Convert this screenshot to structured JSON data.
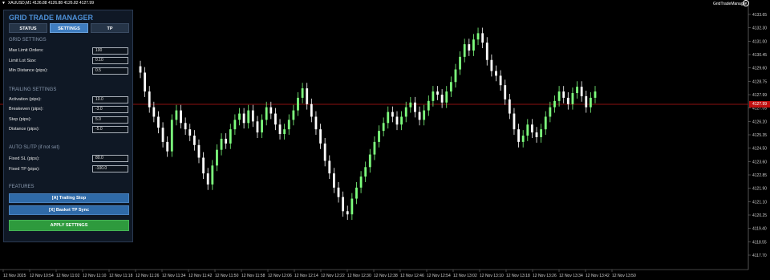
{
  "chart_header": {
    "symbol_line": "XAUUSD,M1  4126.88 4126.88 4126.82 4127.99"
  },
  "ea_label": "GridTradeManager",
  "colors": {
    "bull": "#7dff7d",
    "bear": "#ffffff",
    "bid_line": "#8b1010",
    "panel_bg": "#0f1825",
    "accent": "#4d8fd6",
    "apply": "#2e9a3d"
  },
  "current_price": "4127.99",
  "chart_data": {
    "type": "candlestick",
    "price_range": [
      4116.5,
      4133.0
    ],
    "y_ticks": [
      "4133.65",
      "4132.30",
      "4131.00",
      "4130.45",
      "4129.60",
      "4128.75",
      "4127.99",
      "4127.05",
      "4126.20",
      "4125.35",
      "4124.50",
      "4123.60",
      "4122.85",
      "4121.90",
      "4121.10",
      "4120.25",
      "4119.40",
      "4118.55",
      "4117.70"
    ],
    "x_ticks": [
      "12 Nov 2025",
      "12 Nov 10:54",
      "12 Nov 11:02",
      "12 Nov 11:10",
      "12 Nov 11:18",
      "12 Nov 11:26",
      "12 Nov 11:34",
      "12 Nov 11:42",
      "12 Nov 11:50",
      "12 Nov 11:58",
      "12 Nov 12:06",
      "12 Nov 12:14",
      "12 Nov 12:22",
      "12 Nov 12:30",
      "12 Nov 12:38",
      "12 Nov 12:46",
      "12 Nov 12:54",
      "12 Nov 13:02",
      "12 Nov 13:10",
      "12 Nov 13:18",
      "12 Nov 13:26",
      "12 Nov 13:34",
      "12 Nov 13:42",
      "12 Nov 13:50"
    ],
    "closes": [
      4128.8,
      4127.6,
      4126.6,
      4126.0,
      4125.3,
      4124.4,
      4123.8,
      4125.8,
      4126.4,
      4125.6,
      4125.2,
      4124.8,
      4124.2,
      4123.4,
      4122.4,
      4121.7,
      4122.9,
      4123.9,
      4124.6,
      4124.3,
      4125.2,
      4125.8,
      4126.2,
      4125.6,
      4126.4,
      4125.7,
      4125.0,
      4125.8,
      4126.6,
      4126.2,
      4125.5,
      4124.9,
      4125.2,
      4125.8,
      4126.4,
      4127.2,
      4127.8,
      4126.8,
      4126.0,
      4125.2,
      4124.3,
      4123.2,
      4122.4,
      4121.5,
      4120.9,
      4120.0,
      4119.8,
      4120.8,
      4121.5,
      4122.2,
      4122.8,
      4123.6,
      4124.4,
      4125.1,
      4125.6,
      4126.3,
      4126.0,
      4125.5,
      4126.0,
      4126.6,
      4126.9,
      4126.3,
      4125.8,
      4126.4,
      4127.0,
      4127.6,
      4127.4,
      4126.9,
      4127.6,
      4128.2,
      4129.0,
      4129.8,
      4130.6,
      4130.2,
      4130.9,
      4131.3,
      4130.7,
      4129.6,
      4128.9,
      4128.6,
      4128.0,
      4127.1,
      4126.2,
      4125.2,
      4124.4,
      4124.8,
      4125.5,
      4125.0,
      4124.7,
      4125.2,
      4126.0,
      4126.6,
      4127.0,
      4127.6,
      4127.2,
      4126.8,
      4127.5,
      4127.9,
      4127.3,
      4126.6,
      4127.2,
      4127.6
    ]
  },
  "panel": {
    "title": "GRID TRADE MANAGER",
    "tabs": [
      "STATUS",
      "SETTINGS",
      "TP"
    ],
    "grid_section": "GRID SETTINGS",
    "grid_fields": [
      {
        "label": "Max Limit Orders:",
        "value": "100"
      },
      {
        "label": "Limit Lot Size:",
        "value": "0.10"
      },
      {
        "label": "Min Distance (pips):",
        "value": "0.5"
      }
    ],
    "trailing_section": "TRAILING SETTINGS",
    "trailing_fields": [
      {
        "label": "Activation (pips):",
        "value": "10.0"
      },
      {
        "label": "Breakeven (pips):",
        "value": "-3.0"
      },
      {
        "label": "Step (pips):",
        "value": "5.0"
      },
      {
        "label": "Distance (pips):",
        "value": "-5.0"
      }
    ],
    "auto_section": "AUTO SL/TP (if not set)",
    "auto_fields": [
      {
        "label": "Fixed SL (pips):",
        "value": "80.0"
      },
      {
        "label": "Fixed TP (pips):",
        "value": "-100.0"
      }
    ],
    "features_section": "FEATURES",
    "feature_buttons": [
      "[A] Trailing Stop",
      "[X] Basket TP Sync"
    ],
    "apply_button": "APPLY SETTINGS"
  }
}
